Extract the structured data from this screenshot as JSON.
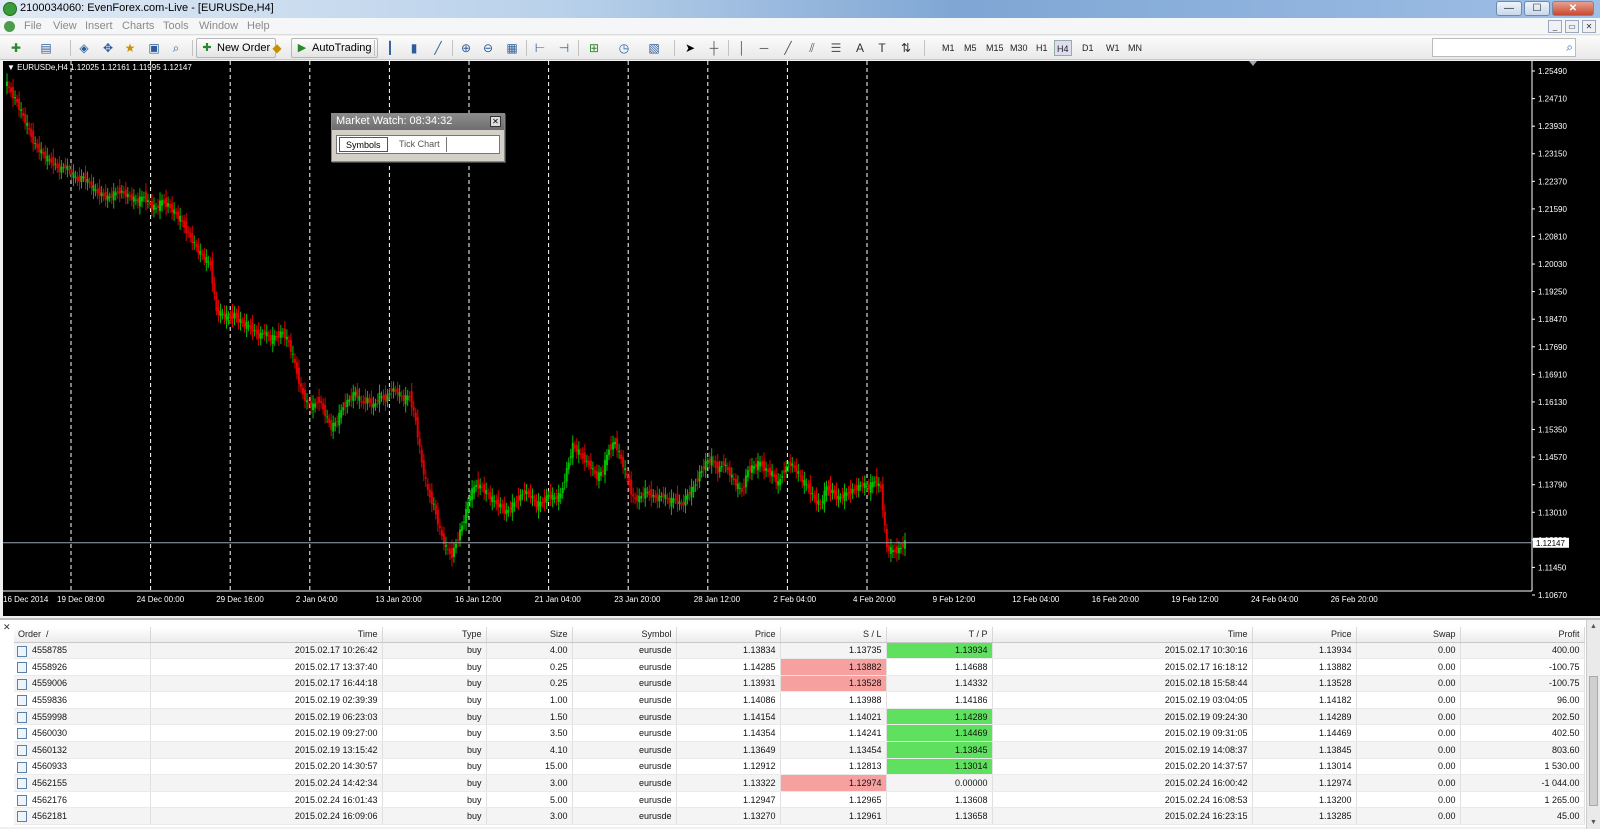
{
  "window": {
    "title": "2100034060: EvenForex.com-Live - [EURUSDe,H4]",
    "buttons": [
      "—",
      "☐",
      "✕"
    ]
  },
  "menu": [
    "File",
    "View",
    "Insert",
    "Charts",
    "Tools",
    "Window",
    "Help"
  ],
  "mdi_buttons": [
    "_",
    "▭",
    "✕"
  ],
  "toolbar": {
    "new_order_label": "New Order",
    "autotrading_label": "AutoTrading",
    "timeframes": [
      "M1",
      "M5",
      "M15",
      "M30",
      "H1",
      "H4",
      "D1",
      "W1",
      "MN"
    ],
    "active_timeframe": "H4",
    "search_value": ""
  },
  "chart": {
    "header": "▼ EURUSDe,H4  1.12025 1.12161 1.11995 1.12147",
    "current_price_label": "1.12147",
    "colors": {
      "up": "#00c000",
      "down": "#e00000",
      "grid": "#ffffff",
      "bg": "#000000",
      "price_line": "#9aa6b4"
    }
  },
  "chart_data": {
    "type": "candlestick",
    "title": "",
    "xlabel": "",
    "ylabel": "",
    "ylim": [
      1.1067,
      1.2549
    ],
    "price_ticks": [
      "1.25490",
      "1.24710",
      "1.23930",
      "1.23150",
      "1.22370",
      "1.21590",
      "1.20810",
      "1.20030",
      "1.19250",
      "1.18470",
      "1.17690",
      "1.16910",
      "1.16130",
      "1.15350",
      "1.14570",
      "1.13790",
      "1.13010",
      "1.12230",
      "1.11450",
      "1.10670"
    ],
    "time_labels": [
      "16 Dec 2014",
      "19 Dec 08:00",
      "24 Dec 00:00",
      "29 Dec 16:00",
      "2 Jan 04:00",
      "13 Jan 20:00",
      "16 Jan 12:00",
      "21 Jan 04:00",
      "23 Jan 20:00",
      "28 Jan 12:00",
      "2 Feb 04:00",
      "4 Feb 20:00",
      "9 Feb 12:00",
      "12 Feb 04:00",
      "16 Feb 20:00",
      "19 Feb 12:00",
      "24 Feb 04:00",
      "26 Feb 20:00"
    ],
    "price_path": [
      1.252,
      1.249,
      1.246,
      1.242,
      1.238,
      1.234,
      1.232,
      1.23,
      1.229,
      1.227,
      1.228,
      1.226,
      1.224,
      1.225,
      1.223,
      1.221,
      1.22,
      1.219,
      1.22,
      1.221,
      1.22,
      1.219,
      1.218,
      1.2195,
      1.217,
      1.216,
      1.218,
      1.217,
      1.215,
      1.213,
      1.21,
      1.207,
      1.204,
      1.202,
      1.2,
      1.187,
      1.186,
      1.185,
      1.186,
      1.184,
      1.183,
      1.182,
      1.18,
      1.181,
      1.179,
      1.18,
      1.181,
      1.178,
      1.172,
      1.165,
      1.161,
      1.16,
      1.162,
      1.158,
      1.154,
      1.156,
      1.16,
      1.162,
      1.164,
      1.161,
      1.162,
      1.16,
      1.163,
      1.162,
      1.165,
      1.164,
      1.162,
      1.163,
      1.156,
      1.144,
      1.136,
      1.132,
      1.125,
      1.12,
      1.118,
      1.123,
      1.128,
      1.135,
      1.138,
      1.137,
      1.135,
      1.133,
      1.132,
      1.13,
      1.132,
      1.134,
      1.136,
      1.135,
      1.132,
      1.133,
      1.135,
      1.134,
      1.135,
      1.142,
      1.149,
      1.147,
      1.145,
      1.143,
      1.14,
      1.142,
      1.148,
      1.15,
      1.145,
      1.14,
      1.134,
      1.134,
      1.136,
      1.135,
      1.134,
      1.135,
      1.133,
      1.134,
      1.132,
      1.135,
      1.137,
      1.141,
      1.144,
      1.145,
      1.142,
      1.144,
      1.141,
      1.138,
      1.136,
      1.142,
      1.143,
      1.144,
      1.142,
      1.141,
      1.138,
      1.142,
      1.144,
      1.142,
      1.139,
      1.137,
      1.134,
      1.132,
      1.137,
      1.136,
      1.134,
      1.135,
      1.136,
      1.137,
      1.138,
      1.137,
      1.139,
      1.137,
      1.12,
      1.119,
      1.1195,
      1.1215
    ]
  },
  "market_watch": {
    "title": "Market Watch: 08:34:32",
    "tabs": [
      "Symbols",
      "Tick Chart"
    ]
  },
  "orders": {
    "columns": [
      "Order",
      "Time",
      "Type",
      "Size",
      "Symbol",
      "Price",
      "S / L",
      "T / P",
      "Time",
      "Price",
      "Swap",
      "Profit"
    ],
    "sort_indicator": "/",
    "rows": [
      {
        "order": "4558785",
        "open_time": "2015.02.17 10:26:42",
        "type": "buy",
        "size": "4.00",
        "symbol": "eurusde",
        "price": "1.13834",
        "sl": "1.13735",
        "tp": "1.13934",
        "close_time": "2015.02.17 10:30:16",
        "close_price": "1.13934",
        "swap": "0.00",
        "profit": "400.00",
        "hl": "tp"
      },
      {
        "order": "4558926",
        "open_time": "2015.02.17 13:37:40",
        "type": "buy",
        "size": "0.25",
        "symbol": "eurusde",
        "price": "1.14285",
        "sl": "1.13882",
        "tp": "1.14688",
        "close_time": "2015.02.17 16:18:12",
        "close_price": "1.13882",
        "swap": "0.00",
        "profit": "-100.75",
        "hl": "sl"
      },
      {
        "order": "4559006",
        "open_time": "2015.02.17 16:44:18",
        "type": "buy",
        "size": "0.25",
        "symbol": "eurusde",
        "price": "1.13931",
        "sl": "1.13528",
        "tp": "1.14332",
        "close_time": "2015.02.18 15:58:44",
        "close_price": "1.13528",
        "swap": "0.00",
        "profit": "-100.75",
        "hl": "sl"
      },
      {
        "order": "4559836",
        "open_time": "2015.02.19 02:39:39",
        "type": "buy",
        "size": "1.00",
        "symbol": "eurusde",
        "price": "1.14086",
        "sl": "1.13988",
        "tp": "1.14186",
        "close_time": "2015.02.19 03:04:05",
        "close_price": "1.14182",
        "swap": "0.00",
        "profit": "96.00",
        "hl": ""
      },
      {
        "order": "4559998",
        "open_time": "2015.02.19 06:23:03",
        "type": "buy",
        "size": "1.50",
        "symbol": "eurusde",
        "price": "1.14154",
        "sl": "1.14021",
        "tp": "1.14289",
        "close_time": "2015.02.19 09:24:30",
        "close_price": "1.14289",
        "swap": "0.00",
        "profit": "202.50",
        "hl": "tp"
      },
      {
        "order": "4560030",
        "open_time": "2015.02.19 09:27:00",
        "type": "buy",
        "size": "3.50",
        "symbol": "eurusde",
        "price": "1.14354",
        "sl": "1.14241",
        "tp": "1.14469",
        "close_time": "2015.02.19 09:31:05",
        "close_price": "1.14469",
        "swap": "0.00",
        "profit": "402.50",
        "hl": "tp"
      },
      {
        "order": "4560132",
        "open_time": "2015.02.19 13:15:42",
        "type": "buy",
        "size": "4.10",
        "symbol": "eurusde",
        "price": "1.13649",
        "sl": "1.13454",
        "tp": "1.13845",
        "close_time": "2015.02.19 14:08:37",
        "close_price": "1.13845",
        "swap": "0.00",
        "profit": "803.60",
        "hl": "tp"
      },
      {
        "order": "4560933",
        "open_time": "2015.02.20 14:30:57",
        "type": "buy",
        "size": "15.00",
        "symbol": "eurusde",
        "price": "1.12912",
        "sl": "1.12813",
        "tp": "1.13014",
        "close_time": "2015.02.20 14:37:57",
        "close_price": "1.13014",
        "swap": "0.00",
        "profit": "1 530.00",
        "hl": "tp"
      },
      {
        "order": "4562155",
        "open_time": "2015.02.24 14:42:34",
        "type": "buy",
        "size": "3.00",
        "symbol": "eurusde",
        "price": "1.13322",
        "sl": "1.12974",
        "tp": "0.00000",
        "close_time": "2015.02.24 16:00:42",
        "close_price": "1.12974",
        "swap": "0.00",
        "profit": "-1 044.00",
        "hl": "sl"
      },
      {
        "order": "4562176",
        "open_time": "2015.02.24 16:01:43",
        "type": "buy",
        "size": "5.00",
        "symbol": "eurusde",
        "price": "1.12947",
        "sl": "1.12965",
        "tp": "1.13608",
        "close_time": "2015.02.24 16:08:53",
        "close_price": "1.13200",
        "swap": "0.00",
        "profit": "1 265.00",
        "hl": ""
      },
      {
        "order": "4562181",
        "open_time": "2015.02.24 16:09:06",
        "type": "buy",
        "size": "3.00",
        "symbol": "eurusde",
        "price": "1.13270",
        "sl": "1.12961",
        "tp": "1.13658",
        "close_time": "2015.02.24 16:23:15",
        "close_price": "1.13285",
        "swap": "0.00",
        "profit": "45.00",
        "hl": ""
      }
    ]
  }
}
